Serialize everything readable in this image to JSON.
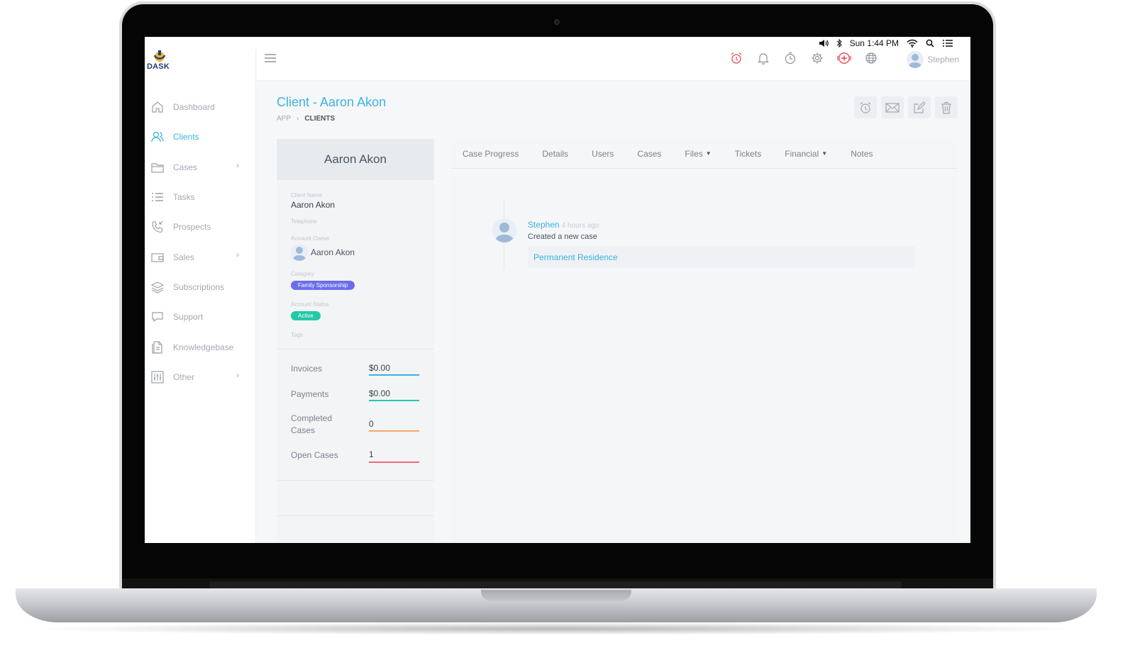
{
  "menubar": {
    "clock": "Sun 1:44 PM",
    "icons": [
      "volume-icon",
      "bluetooth-icon",
      "wifi-icon",
      "spotlight-search-icon",
      "control-list-icon"
    ]
  },
  "brand": {
    "logo_text": "DASK"
  },
  "sidebar": {
    "items": [
      {
        "label": "Dashboard",
        "icon": "home-icon",
        "active": false,
        "has_children": false
      },
      {
        "label": "Clients",
        "icon": "users-icon",
        "active": true,
        "has_children": false
      },
      {
        "label": "Cases",
        "icon": "folder-icon",
        "active": false,
        "has_children": true
      },
      {
        "label": "Tasks",
        "icon": "list-icon",
        "active": false,
        "has_children": false
      },
      {
        "label": "Prospects",
        "icon": "phone-icon",
        "active": false,
        "has_children": false
      },
      {
        "label": "Sales",
        "icon": "wallet-icon",
        "active": false,
        "has_children": true
      },
      {
        "label": "Subscriptions",
        "icon": "layers-icon",
        "active": false,
        "has_children": false
      },
      {
        "label": "Support",
        "icon": "chat-icon",
        "active": false,
        "has_children": false
      },
      {
        "label": "Knowledgebase",
        "icon": "document-icon",
        "active": false,
        "has_children": false
      },
      {
        "label": "Other",
        "icon": "sliders-icon",
        "active": false,
        "has_children": true
      }
    ]
  },
  "topbar": {
    "icons": [
      "alarm-clock-icon",
      "bell-icon",
      "timer-icon",
      "settings-icon",
      "add-circle-icon",
      "globe-icon"
    ],
    "user_name": "Stephen"
  },
  "page": {
    "title": "Client - Aaron Akon",
    "breadcrumb": {
      "root": "APP",
      "current": "CLIENTS"
    },
    "action_icons": [
      "reminder-icon",
      "email-icon",
      "edit-icon",
      "delete-icon"
    ]
  },
  "client_card": {
    "name": "Aaron Akon",
    "client_name_label": "Client Name",
    "client_name": "Aaron Akon",
    "telephone_label": "Telephone",
    "account_owner_label": "Account Owner",
    "account_owner": "Aaron Akon",
    "category_label": "Category",
    "category": "Family Sponsorship",
    "account_status_label": "Account Status",
    "account_status": "Active",
    "tags_label": "Tags",
    "stats": [
      {
        "label": "Invoices",
        "value": "$0.00",
        "color": "#3ab3e0"
      },
      {
        "label": "Payments",
        "value": "$0.00",
        "color": "#22c9a6"
      },
      {
        "label": "Completed Cases",
        "value": "0",
        "color": "#f6a76a"
      },
      {
        "label": "Open Cases",
        "value": "1",
        "color": "#ef6b7b"
      }
    ]
  },
  "tabs": [
    {
      "label": "Case Progress",
      "dropdown": false
    },
    {
      "label": "Details",
      "dropdown": false
    },
    {
      "label": "Users",
      "dropdown": false
    },
    {
      "label": "Cases",
      "dropdown": false
    },
    {
      "label": "Files",
      "dropdown": true
    },
    {
      "label": "Tickets",
      "dropdown": false
    },
    {
      "label": "Financial",
      "dropdown": true
    },
    {
      "label": "Notes",
      "dropdown": false
    }
  ],
  "timeline": {
    "author": "Stephen",
    "time": "4 hours ago",
    "action": "Created a new case",
    "link": "Permanent Residence"
  },
  "colors": {
    "accent": "#3ab3e0",
    "category_badge": "#6a6ee8",
    "status_badge": "#22c9a6",
    "notification_red": "#e8505b"
  }
}
